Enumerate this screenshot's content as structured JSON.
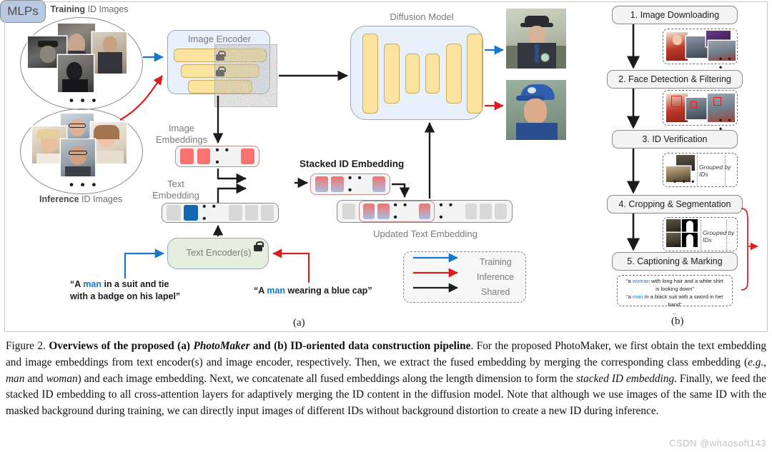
{
  "figure": {
    "panel_a_label": "(a)",
    "panel_b_label": "(b)"
  },
  "panel_a": {
    "training_oval_caption_bold": "Training",
    "training_oval_caption_rest": " ID Images",
    "inference_oval_caption_bold": "Inference",
    "inference_oval_caption_rest": " ID Images",
    "image_encoder_title": "Image Encoder",
    "image_embeddings_label_line1": "Image",
    "image_embeddings_label_line2": "Embeddings",
    "text_embedding_label_line1": "Text",
    "text_embedding_label_line2": "Embedding",
    "mlps_label": "MLPs",
    "text_encoder_label": "Text Encoder(s)",
    "stacked_id_embedding_label": "Stacked ID Embedding",
    "updated_text_embedding_label": "Updated Text Embedding",
    "diffusion_model_title": "Diffusion Model",
    "dots": "• • •",
    "prompt_training_parts": [
      "“A ",
      "man",
      " in a suit and tie"
    ],
    "prompt_training_line2": "with a badge on his lapel”",
    "prompt_inference_parts": [
      "“A ",
      "man",
      " wearing a blue cap”"
    ],
    "legend": [
      {
        "label": "Training",
        "color": "#1a76c9"
      },
      {
        "label": "Inference",
        "color": "#d81f1f"
      },
      {
        "label": "Shared",
        "color": "#1b1b1b"
      }
    ]
  },
  "panel_b": {
    "steps": [
      "1. Image Downloading",
      "2. Face Detection & Filtering",
      "3. ID Verification",
      "4. Cropping & Segmentation",
      "5. Captioning & Marking"
    ],
    "grouped_label": "Grouped by IDs",
    "dots": "• • •",
    "captions": [
      {
        "pre": "“a ",
        "hl": "woman",
        "post": " with long hair and a white shirt"
      },
      {
        "pre": "",
        "hl": "",
        "post": "is looking down”"
      },
      {
        "pre": "“a ",
        "hl": "man",
        "post": " in a black suit with a sword in her"
      },
      {
        "pre": "",
        "hl": "",
        "post": "hand”"
      },
      {
        "pre": "",
        "hl": "",
        "post": "..."
      }
    ]
  },
  "caption": {
    "figure_number": "Figure 2.",
    "bold_title": " Overviews of the proposed (a) ",
    "italic_1": "PhotoMaker",
    "bold_mid": " and (b) ID-oriented data construction pipeline",
    "body": ". For the proposed PhotoMaker, we first obtain the text embedding and image embeddings from text encoder(s) and image encoder, respectively. Then, we extract the fused embedding by merging the corresponding class embedding (",
    "italic_eg": "e.g.",
    "body2": ", ",
    "italic_man": "man",
    "body3": " and ",
    "italic_woman": "woman",
    "body4": ") and each image embedding. Next, we concatenate all fused embeddings along the length dimension to form the ",
    "italic_stacked": "stacked ID embedding",
    "body5": ". Finally, we feed the stacked ID embedding to all cross-attention layers for adaptively merging the ID content in the diffusion model. Note that although we use images of the same ID with the masked background during training, we can directly input images of different IDs without background distortion to create a new ID during inference."
  },
  "watermark": "CSDN @whaosoft143",
  "colors": {
    "training_arrow": "#1a76c9",
    "inference_arrow": "#d81f1f",
    "shared_arrow": "#1b1b1b",
    "encoder_fill": "#e8f0fb",
    "text_encoder_fill": "#e4efe0",
    "yellow_block": "#fbe3a0",
    "mlp_fill": "#b8c9e4",
    "highlight_text": "#1877c9"
  }
}
